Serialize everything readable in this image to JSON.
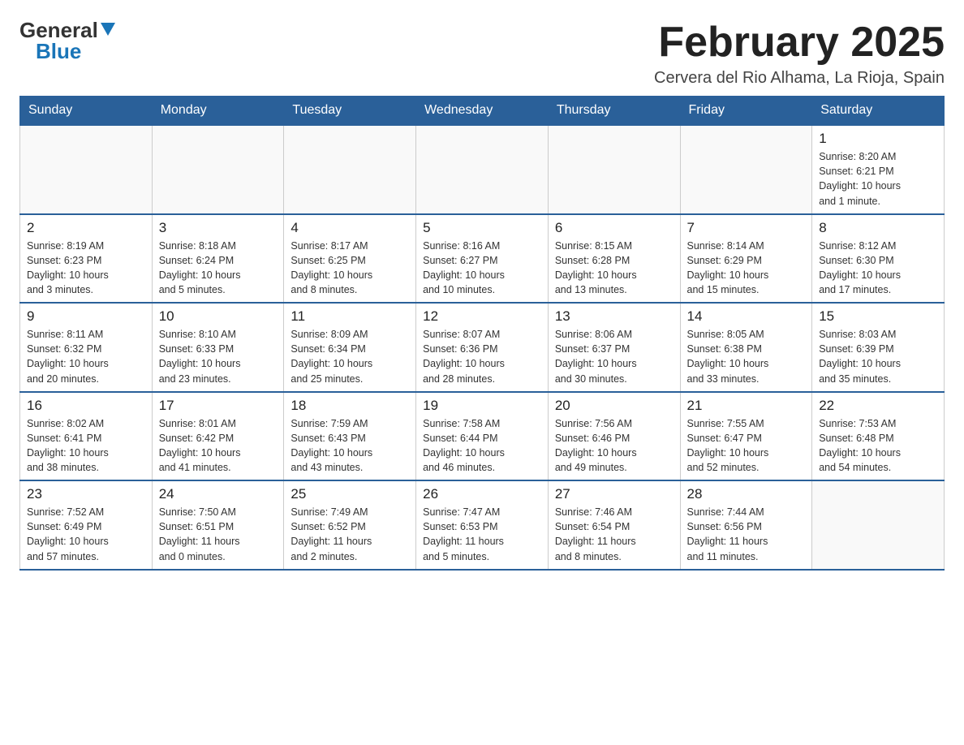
{
  "logo": {
    "general": "General",
    "blue_accent": "▲",
    "blue": "Blue"
  },
  "header": {
    "title": "February 2025",
    "location": "Cervera del Rio Alhama, La Rioja, Spain"
  },
  "days_of_week": [
    "Sunday",
    "Monday",
    "Tuesday",
    "Wednesday",
    "Thursday",
    "Friday",
    "Saturday"
  ],
  "weeks": [
    {
      "days": [
        {
          "date": "",
          "info": ""
        },
        {
          "date": "",
          "info": ""
        },
        {
          "date": "",
          "info": ""
        },
        {
          "date": "",
          "info": ""
        },
        {
          "date": "",
          "info": ""
        },
        {
          "date": "",
          "info": ""
        },
        {
          "date": "1",
          "info": "Sunrise: 8:20 AM\nSunset: 6:21 PM\nDaylight: 10 hours\nand 1 minute."
        }
      ]
    },
    {
      "days": [
        {
          "date": "2",
          "info": "Sunrise: 8:19 AM\nSunset: 6:23 PM\nDaylight: 10 hours\nand 3 minutes."
        },
        {
          "date": "3",
          "info": "Sunrise: 8:18 AM\nSunset: 6:24 PM\nDaylight: 10 hours\nand 5 minutes."
        },
        {
          "date": "4",
          "info": "Sunrise: 8:17 AM\nSunset: 6:25 PM\nDaylight: 10 hours\nand 8 minutes."
        },
        {
          "date": "5",
          "info": "Sunrise: 8:16 AM\nSunset: 6:27 PM\nDaylight: 10 hours\nand 10 minutes."
        },
        {
          "date": "6",
          "info": "Sunrise: 8:15 AM\nSunset: 6:28 PM\nDaylight: 10 hours\nand 13 minutes."
        },
        {
          "date": "7",
          "info": "Sunrise: 8:14 AM\nSunset: 6:29 PM\nDaylight: 10 hours\nand 15 minutes."
        },
        {
          "date": "8",
          "info": "Sunrise: 8:12 AM\nSunset: 6:30 PM\nDaylight: 10 hours\nand 17 minutes."
        }
      ]
    },
    {
      "days": [
        {
          "date": "9",
          "info": "Sunrise: 8:11 AM\nSunset: 6:32 PM\nDaylight: 10 hours\nand 20 minutes."
        },
        {
          "date": "10",
          "info": "Sunrise: 8:10 AM\nSunset: 6:33 PM\nDaylight: 10 hours\nand 23 minutes."
        },
        {
          "date": "11",
          "info": "Sunrise: 8:09 AM\nSunset: 6:34 PM\nDaylight: 10 hours\nand 25 minutes."
        },
        {
          "date": "12",
          "info": "Sunrise: 8:07 AM\nSunset: 6:36 PM\nDaylight: 10 hours\nand 28 minutes."
        },
        {
          "date": "13",
          "info": "Sunrise: 8:06 AM\nSunset: 6:37 PM\nDaylight: 10 hours\nand 30 minutes."
        },
        {
          "date": "14",
          "info": "Sunrise: 8:05 AM\nSunset: 6:38 PM\nDaylight: 10 hours\nand 33 minutes."
        },
        {
          "date": "15",
          "info": "Sunrise: 8:03 AM\nSunset: 6:39 PM\nDaylight: 10 hours\nand 35 minutes."
        }
      ]
    },
    {
      "days": [
        {
          "date": "16",
          "info": "Sunrise: 8:02 AM\nSunset: 6:41 PM\nDaylight: 10 hours\nand 38 minutes."
        },
        {
          "date": "17",
          "info": "Sunrise: 8:01 AM\nSunset: 6:42 PM\nDaylight: 10 hours\nand 41 minutes."
        },
        {
          "date": "18",
          "info": "Sunrise: 7:59 AM\nSunset: 6:43 PM\nDaylight: 10 hours\nand 43 minutes."
        },
        {
          "date": "19",
          "info": "Sunrise: 7:58 AM\nSunset: 6:44 PM\nDaylight: 10 hours\nand 46 minutes."
        },
        {
          "date": "20",
          "info": "Sunrise: 7:56 AM\nSunset: 6:46 PM\nDaylight: 10 hours\nand 49 minutes."
        },
        {
          "date": "21",
          "info": "Sunrise: 7:55 AM\nSunset: 6:47 PM\nDaylight: 10 hours\nand 52 minutes."
        },
        {
          "date": "22",
          "info": "Sunrise: 7:53 AM\nSunset: 6:48 PM\nDaylight: 10 hours\nand 54 minutes."
        }
      ]
    },
    {
      "days": [
        {
          "date": "23",
          "info": "Sunrise: 7:52 AM\nSunset: 6:49 PM\nDaylight: 10 hours\nand 57 minutes."
        },
        {
          "date": "24",
          "info": "Sunrise: 7:50 AM\nSunset: 6:51 PM\nDaylight: 11 hours\nand 0 minutes."
        },
        {
          "date": "25",
          "info": "Sunrise: 7:49 AM\nSunset: 6:52 PM\nDaylight: 11 hours\nand 2 minutes."
        },
        {
          "date": "26",
          "info": "Sunrise: 7:47 AM\nSunset: 6:53 PM\nDaylight: 11 hours\nand 5 minutes."
        },
        {
          "date": "27",
          "info": "Sunrise: 7:46 AM\nSunset: 6:54 PM\nDaylight: 11 hours\nand 8 minutes."
        },
        {
          "date": "28",
          "info": "Sunrise: 7:44 AM\nSunset: 6:56 PM\nDaylight: 11 hours\nand 11 minutes."
        },
        {
          "date": "",
          "info": ""
        }
      ]
    }
  ]
}
